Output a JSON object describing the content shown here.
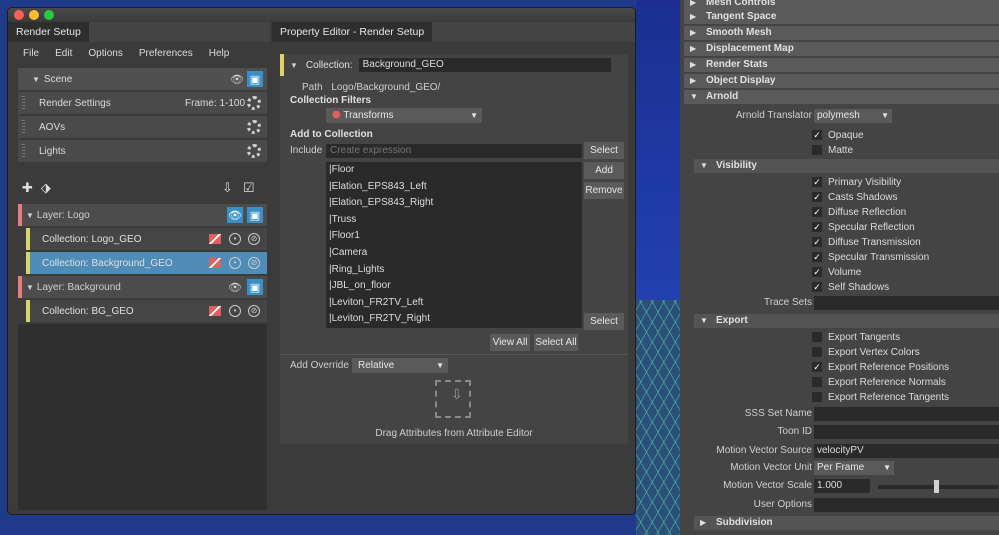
{
  "render_setup": {
    "tab_title": "Render Setup",
    "menu": [
      "File",
      "Edit",
      "Options",
      "Preferences",
      "Help"
    ],
    "scene_label": "Scene",
    "render_settings_label": "Render Settings",
    "frame_range": "Frame: 1-100",
    "aovs_label": "AOVs",
    "lights_label": "Lights",
    "layers": [
      {
        "label": "Layer:  Logo",
        "collections": [
          "Collection:   Logo_GEO",
          "Collection:   Background_GEO"
        ]
      },
      {
        "label": "Layer:  Background",
        "collections": [
          "Collection:   BG_GEO"
        ]
      }
    ]
  },
  "property_editor": {
    "tab_title": "Property Editor - Render Setup",
    "collection_label": "Collection:",
    "collection_name": "Background_GEO",
    "path_label": "Path",
    "path_value": "Logo/Background_GEO/",
    "filters_label": "Collection Filters",
    "filter_value": "Transforms",
    "add_label": "Add to Collection",
    "include_label": "Include",
    "include_placeholder": "Create expression",
    "select_button": "Select",
    "add_button": "Add",
    "remove_button": "Remove",
    "items": [
      "|Floor",
      "|Elation_EPS843_Left",
      "|Elation_EPS843_Right",
      "|Truss",
      "|Floor1",
      "|Camera",
      "|Ring_Lights",
      "|JBL_on_floor",
      "|Leviton_FR2TV_Left",
      "|Leviton_FR2TV_Right"
    ],
    "select_button2": "Select",
    "view_all": "View All",
    "select_all": "Select All",
    "override_label": "Add Override",
    "override_value": "Relative",
    "drag_text": "Drag Attributes from Attribute Editor"
  },
  "attribute_editor": {
    "sections_top": [
      "Mesh Controls",
      "Tangent Space",
      "Smooth Mesh",
      "Displacement Map",
      "Render Stats",
      "Object Display",
      "Arnold"
    ],
    "translator_label": "Arnold Translator",
    "translator_value": "polymesh",
    "opaque": "Opaque",
    "matte": "Matte",
    "visibility": "Visibility",
    "vis_items": [
      "Primary Visibility",
      "Casts Shadows",
      "Diffuse Reflection",
      "Specular Reflection",
      "Diffuse Transmission",
      "Specular Transmission",
      "Volume",
      "Self Shadows"
    ],
    "trace_sets": "Trace Sets",
    "export": "Export",
    "export_items": [
      "Export Tangents",
      "Export Vertex Colors",
      "Export Reference Positions",
      "Export Reference Normals",
      "Export Reference Tangents"
    ],
    "sss_set_name": "SSS Set Name",
    "toon_id": "Toon ID",
    "mv_source_label": "Motion Vector Source",
    "mv_source_value": "velocityPV",
    "mv_unit_label": "Motion Vector Unit",
    "mv_unit_value": "Per Frame",
    "mv_scale_label": "Motion Vector Scale",
    "mv_scale_value": "1.000",
    "user_options": "User Options",
    "subdivision": "Subdivision"
  }
}
